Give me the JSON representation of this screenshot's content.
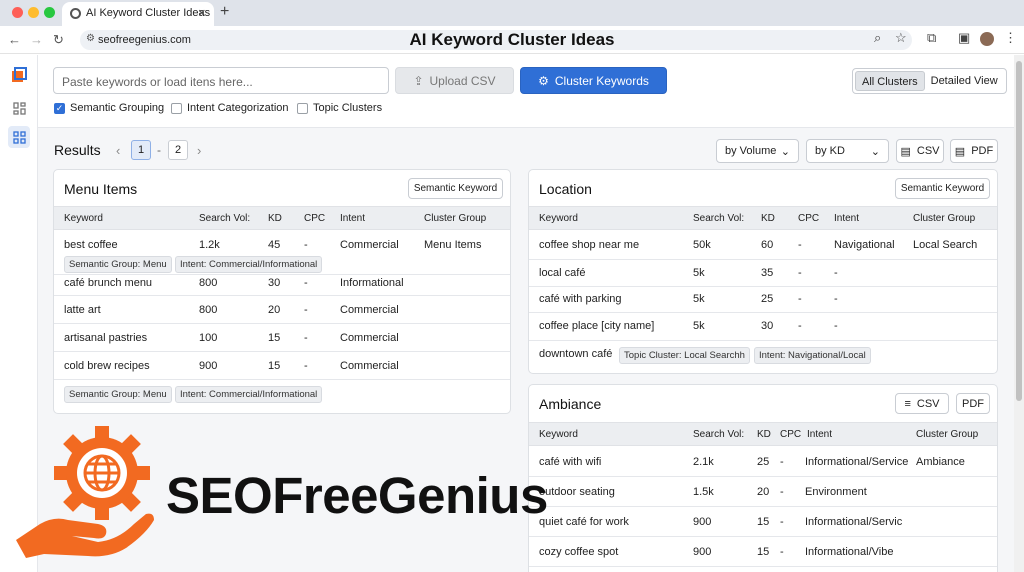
{
  "browser": {
    "tab_title": "AI Keyword Cluster Ideas",
    "url": "seofreegenius.com",
    "page_title": "AI Keyword Cluster Ideas"
  },
  "toolbar": {
    "input_placeholder": "Paste keywords or load itens here...",
    "upload_label": "Upload CSV",
    "cluster_label": "Cluster Keywords",
    "view_all": "All Clusters",
    "view_detail": "Detailed View",
    "options": [
      {
        "label": "Semantic Grouping",
        "checked": true
      },
      {
        "label": "Intent Categorization",
        "checked": false
      },
      {
        "label": "Topic Clusters",
        "checked": false
      }
    ]
  },
  "results": {
    "title": "Results",
    "pages": [
      "1",
      "2"
    ],
    "sort_volume": "by Volume",
    "sort_kd": "by KD",
    "csv": "CSV",
    "pdf": "PDF"
  },
  "menu_card": {
    "title": "Menu Items",
    "button": "Semantic Keyword",
    "headers": [
      "Keyword",
      "Search Vol:",
      "KD",
      "CPC",
      "Intent",
      "Cluster Group"
    ],
    "rows": [
      [
        "best coffee",
        "1.2k",
        "45",
        "-",
        "Commercial",
        "Menu Items"
      ],
      [
        "café brunch menu",
        "800",
        "30",
        "-",
        "Informational",
        ""
      ],
      [
        "latte art",
        "800",
        "20",
        "-",
        "Commercial",
        ""
      ],
      [
        "artisanal pastries",
        "100",
        "15",
        "-",
        "Commercial",
        ""
      ],
      [
        "cold brew recipes",
        "900",
        "15",
        "-",
        "Commercial",
        ""
      ]
    ],
    "tag1": "Semantic Group: Menu",
    "tag2": "Intent: Commercial/Informational"
  },
  "location_card": {
    "title": "Location",
    "button": "Semantic Keyword",
    "headers": [
      "Keyword",
      "Search Vol:",
      "KD",
      "CPC",
      "Intent",
      "Cluster Group"
    ],
    "rows": [
      [
        "coffee shop near me",
        "50k",
        "60",
        "-",
        "Navigational",
        "Local Search"
      ],
      [
        "local café",
        "5k",
        "35",
        "-",
        "-",
        ""
      ],
      [
        "café with parking",
        "5k",
        "25",
        "-",
        "-",
        ""
      ],
      [
        "coffee place [city name]",
        "5k",
        "30",
        "-",
        "-",
        ""
      ]
    ],
    "last_keyword": "downtown café",
    "tag1": "Topic Cluster: Local Searchh",
    "tag2": "Intent: Navigational/Local"
  },
  "ambiance_card": {
    "title": "Ambiance",
    "csv": "CSV",
    "pdf": "PDF",
    "headers": [
      "Keyword",
      "Search Vol:",
      "KD",
      "CPC",
      "Intent",
      "Cluster Group"
    ],
    "rows": [
      [
        "café with wifi",
        "2.1k",
        "25",
        "-",
        "Informational/Service",
        "Ambiance"
      ],
      [
        "outdoor seating",
        "1.5k",
        "20",
        "-",
        "Environment",
        ""
      ],
      [
        "quiet café for work",
        "900",
        "15",
        "-",
        "Informational/Servic",
        ""
      ],
      [
        "cozy coffee spot",
        "900",
        "15",
        "-",
        "Informational/Vibe",
        ""
      ]
    ]
  },
  "brand": {
    "name": "SEOFreeGenius",
    "color": "#f26a21"
  }
}
